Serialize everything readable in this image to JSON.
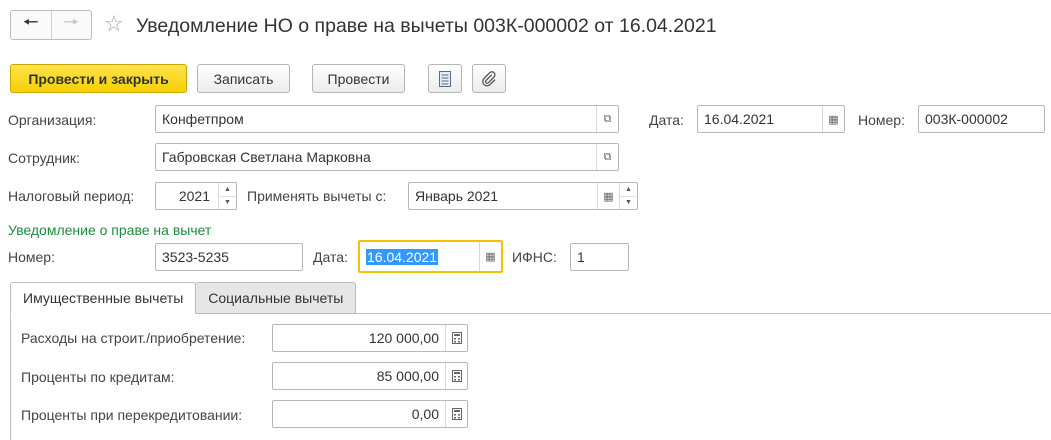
{
  "window": {
    "title": "Уведомление НО о праве на вычеты 003К-000002 от 16.04.2021"
  },
  "toolbar": {
    "post_close": "Провести и закрыть",
    "save": "Записать",
    "post": "Провести"
  },
  "header": {
    "organization_label": "Организация:",
    "organization_value": "Конфетпром",
    "date_label": "Дата:",
    "date_value": "16.04.2021",
    "number_label": "Номер:",
    "number_value": "003К-000002",
    "employee_label": "Сотрудник:",
    "employee_value": "Габровская Светлана Марковна",
    "tax_period_label": "Налоговый период:",
    "tax_period_value": "2021",
    "apply_from_label": "Применять вычеты с:",
    "apply_from_value": "Январь 2021"
  },
  "notice": {
    "section_title": "Уведомление о праве на вычет",
    "number_label": "Номер:",
    "number_value": "3523-5235",
    "date_label": "Дата:",
    "date_value": "16.04.2021",
    "ifns_label": "ИФНС:",
    "ifns_value": "1"
  },
  "tabs": [
    {
      "label": "Имущественные вычеты"
    },
    {
      "label": "Социальные вычеты"
    }
  ],
  "property_deductions": {
    "construction_label": "Расходы на строит./приобретение:",
    "construction_value": "120 000,00",
    "credit_interest_label": "Проценты по кредитам:",
    "credit_interest_value": "85 000,00",
    "refinancing_label": "Проценты при перекредитовании:",
    "refinancing_value": "0,00"
  },
  "colors": {
    "primary_button": "#f5cf06",
    "section_title": "#1a8f3a",
    "focus_border": "#f3c300",
    "selection": "#3399ff"
  }
}
